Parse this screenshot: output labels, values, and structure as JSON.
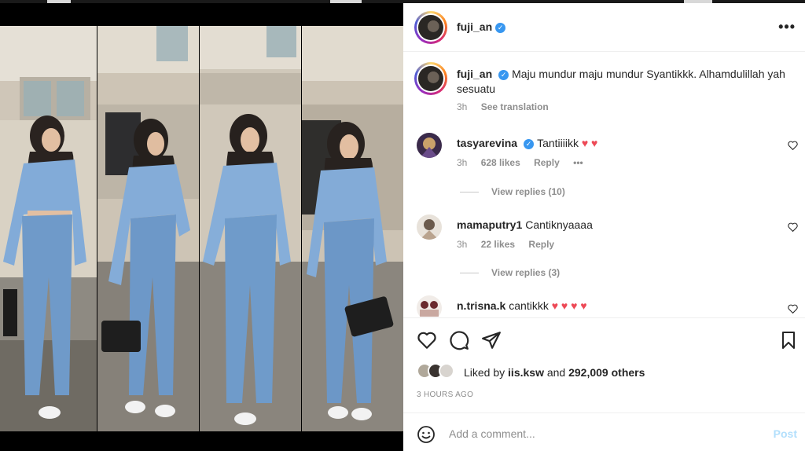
{
  "post": {
    "username": "fuji_an",
    "verified": true,
    "more_label": "•••"
  },
  "caption": {
    "username": "fuji_an",
    "text": "Maju mundur maju mundur Syantikkk. Alhamdulillah yah sesuatu",
    "time": "3h",
    "translate_label": "See translation"
  },
  "comments": [
    {
      "username": "tasyarevina",
      "verified": true,
      "text": "Tantiiiikk",
      "hearts": "♥ ♥",
      "time": "3h",
      "likes": "628 likes",
      "reply_label": "Reply",
      "more": "•••",
      "view_replies": "View replies (10)"
    },
    {
      "username": "mamaputry1",
      "verified": false,
      "text": "Cantiknyaaaa",
      "hearts": "",
      "time": "3h",
      "likes": "22 likes",
      "reply_label": "Reply",
      "view_replies": "View replies (3)"
    },
    {
      "username": "n.trisna.k",
      "verified": false,
      "text": "cantikkk",
      "hearts": "♥ ♥ ♥ ♥"
    }
  ],
  "engagement": {
    "liked_prefix": "Liked by",
    "liked_user": "iis.ksw",
    "liked_and": "and",
    "liked_others": "292,009 others",
    "time_ago": "3 HOURS AGO"
  },
  "add_comment": {
    "placeholder": "Add a comment...",
    "post_label": "Post"
  },
  "colors": {
    "accent": "#3897f0",
    "heart": "#ed4956",
    "post_disabled": "#b2dffc",
    "text": "#262626",
    "muted": "#8e8e8e",
    "denim": "#7fa8d6"
  }
}
